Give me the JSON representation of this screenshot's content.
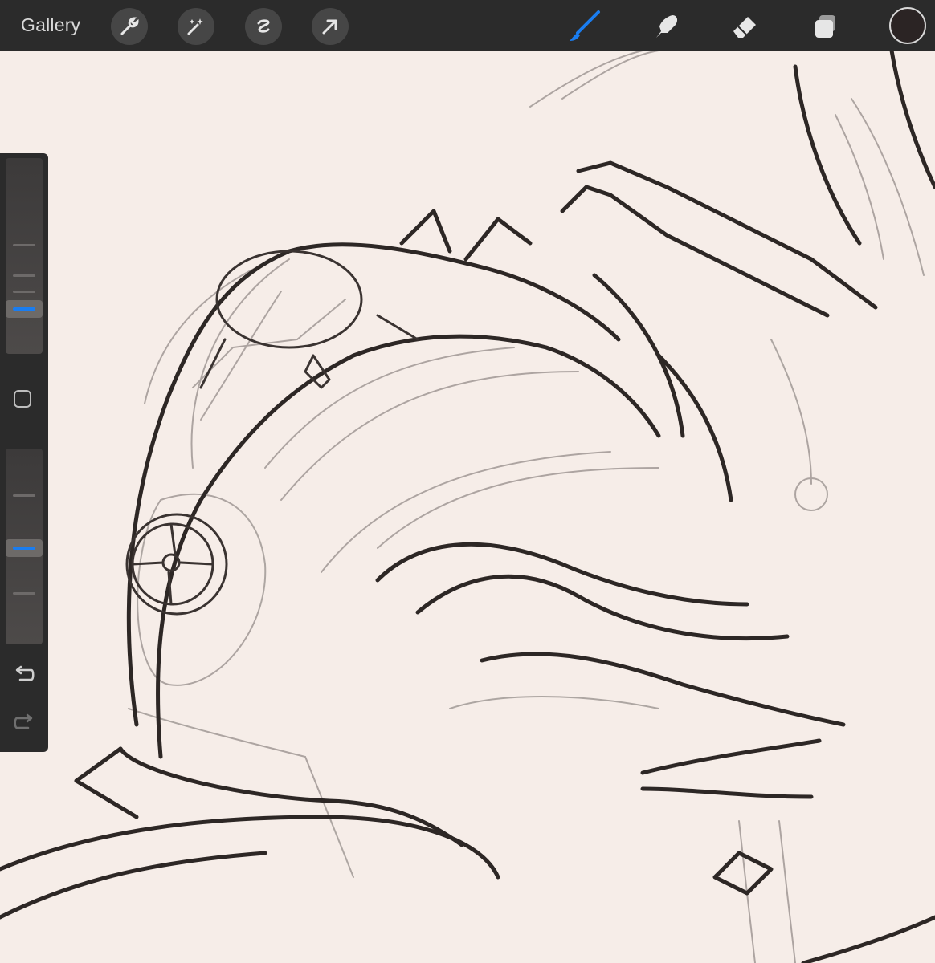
{
  "topbar": {
    "gallery_label": "Gallery",
    "left_tools": [
      "wrench-icon",
      "magic-wand-icon",
      "selection-icon",
      "transform-arrow-icon"
    ],
    "right_tools": [
      "brush-icon",
      "smudge-icon",
      "eraser-icon",
      "layers-icon"
    ],
    "active_tool": "brush-icon",
    "accent_color": "#1a7df0",
    "current_color": "#2b2424"
  },
  "sidebar": {
    "brush_size_level": 0.75,
    "opacity_level": 0.5,
    "icons": [
      "modify-square-icon",
      "undo-icon",
      "redo-icon"
    ]
  },
  "canvas": {
    "background": "#f6ede8"
  }
}
